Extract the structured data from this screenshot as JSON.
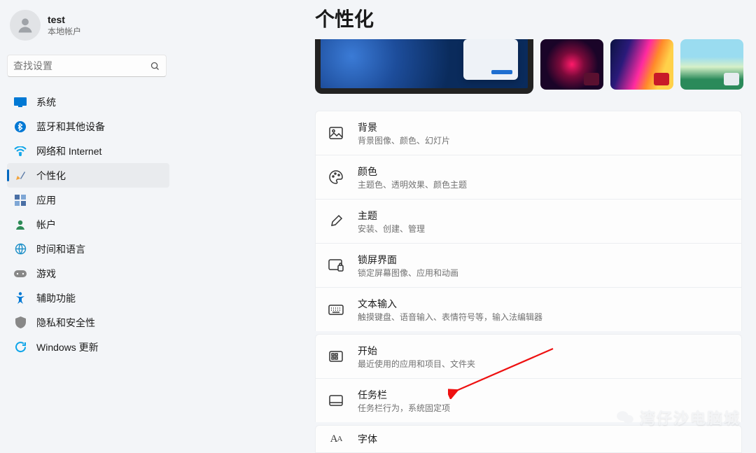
{
  "user": {
    "name": "test",
    "subtitle": "本地帐户"
  },
  "search": {
    "placeholder": "查找设置"
  },
  "nav": {
    "items": [
      {
        "label": "系统"
      },
      {
        "label": "蓝牙和其他设备"
      },
      {
        "label": "网络和 Internet"
      },
      {
        "label": "个性化"
      },
      {
        "label": "应用"
      },
      {
        "label": "帐户"
      },
      {
        "label": "时间和语言"
      },
      {
        "label": "游戏"
      },
      {
        "label": "辅助功能"
      },
      {
        "label": "隐私和安全性"
      },
      {
        "label": "Windows 更新"
      }
    ]
  },
  "page": {
    "title": "个性化"
  },
  "settings": [
    {
      "title": "背景",
      "desc": "背景图像、颜色、幻灯片"
    },
    {
      "title": "颜色",
      "desc": "主题色、透明效果、颜色主题"
    },
    {
      "title": "主题",
      "desc": "安装、创建、管理"
    },
    {
      "title": "锁屏界面",
      "desc": "锁定屏幕图像、应用和动画"
    },
    {
      "title": "文本输入",
      "desc": "触摸键盘、语音输入、表情符号等，输入法编辑器"
    },
    {
      "title": "开始",
      "desc": "最近使用的应用和项目、文件夹"
    },
    {
      "title": "任务栏",
      "desc": "任务栏行为，系统固定项"
    },
    {
      "title": "字体",
      "desc": ""
    }
  ],
  "watermark": {
    "text": "湾仔沙电脑城"
  }
}
